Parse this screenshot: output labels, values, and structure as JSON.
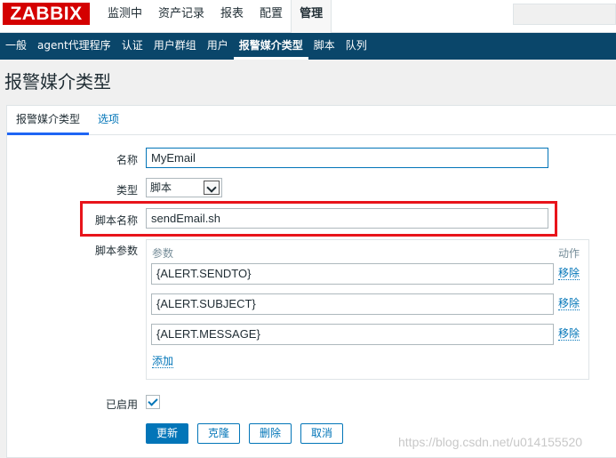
{
  "header": {
    "logo": "ZABBIX",
    "menu": [
      "监测中",
      "资产记录",
      "报表",
      "配置",
      "管理"
    ],
    "active_menu": "管理"
  },
  "subnav": {
    "items": [
      "一般",
      "agent代理程序",
      "认证",
      "用户群组",
      "用户",
      "报警媒介类型",
      "脚本",
      "队列"
    ],
    "active": "报警媒介类型"
  },
  "page_title": "报警媒介类型",
  "tabs": [
    "报警媒介类型",
    "选项"
  ],
  "form": {
    "name_label": "名称",
    "name_value": "MyEmail",
    "type_label": "类型",
    "type_value": "脚本",
    "script_name_label": "脚本名称",
    "script_name_value": "sendEmail.sh",
    "script_params_label": "脚本参数",
    "params_header": "参数",
    "action_header": "动作",
    "params": [
      {
        "value": "{ALERT.SENDTO}",
        "remove": "移除"
      },
      {
        "value": "{ALERT.SUBJECT}",
        "remove": "移除"
      },
      {
        "value": "{ALERT.MESSAGE}",
        "remove": "移除"
      }
    ],
    "add_label": "添加",
    "enabled_label": "已启用",
    "enabled": true
  },
  "buttons": {
    "update": "更新",
    "clone": "克隆",
    "delete": "删除",
    "cancel": "取消"
  },
  "watermark": "https://blog.csdn.net/u014155520",
  "colors": {
    "brand_red": "#d40000",
    "subnav_bg": "#0a466a",
    "accent_blue": "#0275b8",
    "highlight_red": "#e8141b"
  }
}
